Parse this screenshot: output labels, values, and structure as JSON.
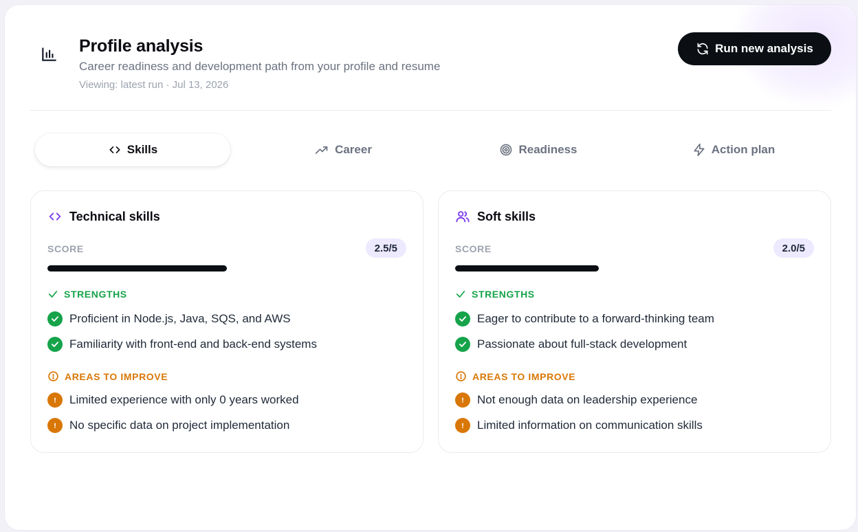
{
  "header": {
    "icon": "bar-chart-icon",
    "title": "Profile analysis",
    "subtitle": "Career readiness and development path from your profile and resume",
    "meta": "Viewing: latest run · Jul 13, 2026",
    "run_button": {
      "label": "Run new analysis",
      "icon": "refresh-icon"
    }
  },
  "tabs": [
    {
      "label": "Skills",
      "icon": "code-icon",
      "active": true
    },
    {
      "label": "Career",
      "icon": "trending-up-icon",
      "active": false
    },
    {
      "label": "Readiness",
      "icon": "target-icon",
      "active": false
    },
    {
      "label": "Action plan",
      "icon": "lightning-icon",
      "active": false
    }
  ],
  "cards": [
    {
      "title": "Technical skills",
      "icon": "code-icon",
      "score_label": "SCORE",
      "score_text": "2.5/5",
      "score_value": 2.5,
      "score_max": 5,
      "strengths_heading": "STRENGTHS",
      "strengths": [
        "Proficient in Node.js, Java, SQS, and AWS",
        "Familiarity with front-end and back-end systems"
      ],
      "improve_heading": "AREAS TO IMPROVE",
      "improve": [
        "Limited experience with only 0 years worked",
        "No specific data on project implementation"
      ]
    },
    {
      "title": "Soft skills",
      "icon": "users-icon",
      "score_label": "SCORE",
      "score_text": "2.0/5",
      "score_value": 2.0,
      "score_max": 5,
      "strengths_heading": "STRENGTHS",
      "strengths": [
        "Eager to contribute to a forward-thinking team",
        "Passionate about full-stack development"
      ],
      "improve_heading": "AREAS TO IMPROVE",
      "improve": [
        "Not enough data on leadership experience",
        "Limited information on communication skills"
      ]
    }
  ],
  "colors": {
    "accent": "#7c3aed",
    "success": "#16a34a",
    "warning": "#d97706",
    "button": "#0b0f14"
  }
}
